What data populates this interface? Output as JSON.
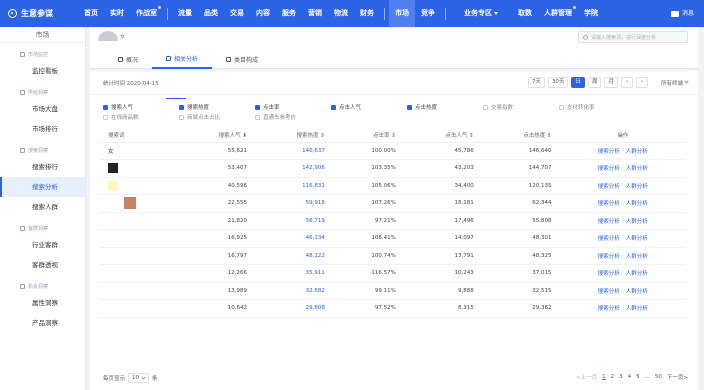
{
  "brand": {
    "name": "生意参谋"
  },
  "nav": {
    "items": [
      {
        "label": "首页"
      },
      {
        "label": "实时"
      },
      {
        "label": "作战室"
      },
      {
        "label": "流量"
      },
      {
        "label": "品类"
      },
      {
        "label": "交易"
      },
      {
        "label": "内容"
      },
      {
        "label": "服务"
      },
      {
        "label": "营销"
      },
      {
        "label": "物流"
      },
      {
        "label": "财务"
      },
      {
        "label": "市场"
      },
      {
        "label": "竞争"
      },
      {
        "label": "业务专区"
      },
      {
        "label": "取数"
      },
      {
        "label": "人群管理"
      },
      {
        "label": "学院"
      }
    ],
    "message": "消息"
  },
  "sidebar": {
    "title": "市场",
    "groups": [
      {
        "label": "市场监控",
        "items": [
          "监控看板"
        ]
      },
      {
        "label": "供给洞察",
        "items": [
          "市场大盘",
          "市场排行"
        ]
      },
      {
        "label": "搜索洞察",
        "items": [
          "搜索排行",
          "搜索分析",
          "搜索人群"
        ]
      },
      {
        "label": "客群洞察",
        "items": [
          "行业客群",
          "客群透视"
        ]
      },
      {
        "label": "机会洞察",
        "items": [
          "属性洞察",
          "产品洞察"
        ]
      }
    ]
  },
  "header": {
    "keyword_tag": "女",
    "search_placeholder": "请输入搜索词，进行深度分析",
    "tabs": [
      {
        "label": "概况"
      },
      {
        "label": "相关分析"
      },
      {
        "label": "类目构成"
      }
    ]
  },
  "stats": {
    "time": "统计时间 2020-04-15",
    "ranges": [
      "7天",
      "30天",
      "日",
      "周",
      "月"
    ],
    "terminal": "所有终端"
  },
  "filters": {
    "row1": [
      {
        "label": "搜索人气",
        "on": true
      },
      {
        "label": "搜索热度",
        "on": true
      },
      {
        "label": "点击率",
        "on": true
      },
      {
        "label": "点击人气",
        "on": true
      },
      {
        "label": "点击热度",
        "on": true
      },
      {
        "label": "交易指数",
        "on": false
      },
      {
        "label": "支付转化率",
        "on": false
      }
    ],
    "row2": [
      {
        "label": "在线商品数",
        "on": false
      },
      {
        "label": "商城点击占比",
        "on": false
      },
      {
        "label": "直通车参考价",
        "on": false
      }
    ]
  },
  "table": {
    "headers": [
      "搜索词",
      "搜索人气 ⬇",
      "搜索热度 ⇕",
      "点击率 ⇕",
      "点击人气 ⇕",
      "点击热度 ⇕",
      "操作"
    ],
    "actions": [
      "搜索分析",
      "人群分析"
    ],
    "rows": [
      {
        "kw": "女",
        "v": [
          "55,621",
          "146,637",
          "100.00%",
          "45,786",
          "146,640"
        ]
      },
      {
        "kw": "",
        "v": [
          "53,407",
          "142,906",
          "103.35%",
          "43,203",
          "144,707"
        ]
      },
      {
        "kw": "",
        "v": [
          "40,596",
          "116,831",
          "105.06%",
          "34,400",
          "120,135"
        ]
      },
      {
        "kw": "",
        "v": [
          "22,555",
          "59,918",
          "107.26%",
          "18,181",
          "62,344"
        ]
      },
      {
        "kw": "",
        "v": [
          "21,820",
          "56,719",
          "97.21%",
          "17,496",
          "55,808"
        ]
      },
      {
        "kw": "",
        "v": [
          "16,925",
          "46,134",
          "108.41%",
          "14,097",
          "48,301"
        ]
      },
      {
        "kw": "",
        "v": [
          "16,797",
          "48,122",
          "100.74%",
          "13,791",
          "48,325"
        ]
      },
      {
        "kw": "",
        "v": [
          "12,266",
          "35,911",
          "116.57%",
          "10,243",
          "37,015"
        ]
      },
      {
        "kw": "",
        "v": [
          "13,989",
          "32,682",
          "99.11%",
          "9,888",
          "32,515"
        ]
      },
      {
        "kw": "",
        "v": [
          "10,642",
          "29,808",
          "97.52%",
          "8,315",
          "29,382"
        ]
      }
    ]
  },
  "pagination": {
    "per_page_label": "每页显示",
    "per_page_value": "10",
    "unit": "条",
    "prev": "<上一页",
    "pages": [
      "1",
      "2",
      "3",
      "4",
      "5",
      "...",
      "50"
    ],
    "next": "下一页>"
  }
}
